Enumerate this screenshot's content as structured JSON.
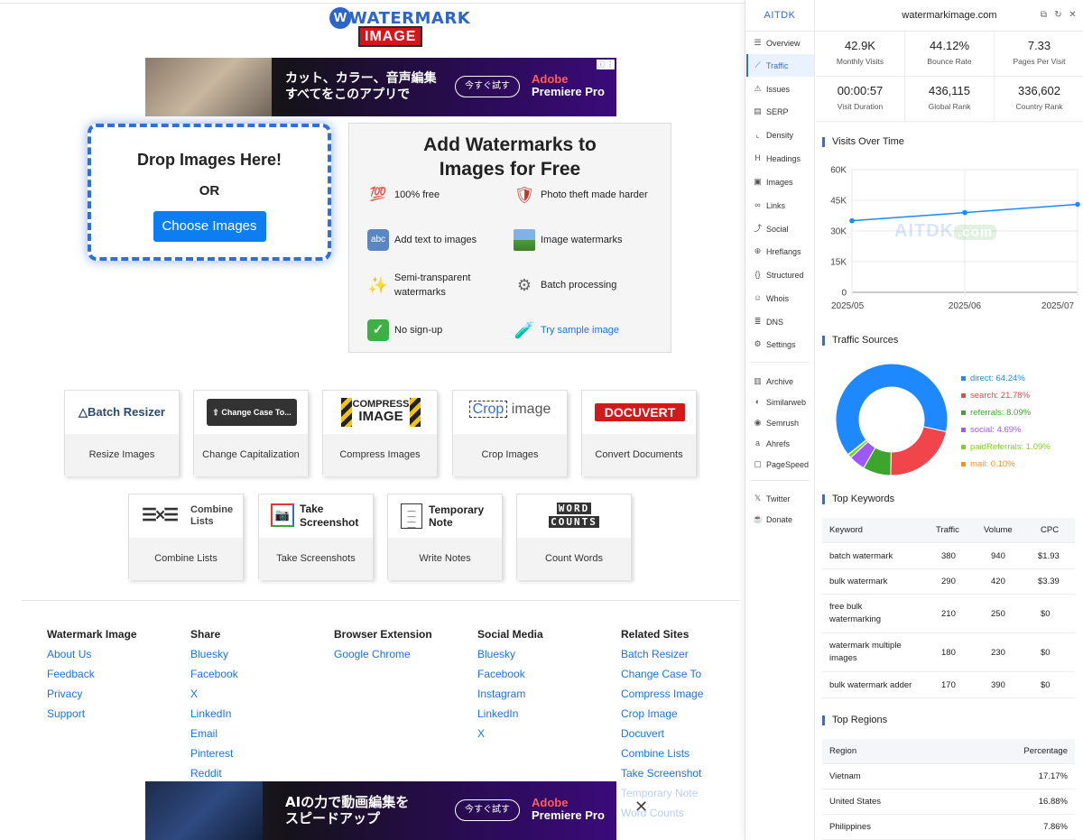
{
  "logo": {
    "word1": "WATERMARK",
    "word2": "IMAGE"
  },
  "ads": {
    "top": {
      "line1": "カット、カラー、音声編集",
      "line2": "すべてをこのアプリで",
      "cta": "今すぐ試す",
      "brand_line1": "Adobe",
      "brand_line2": "Premiere Pro"
    },
    "bottom": {
      "line1": "AIの力で動画編集を",
      "line2": "スピードアップ",
      "cta": "今すぐ試す",
      "brand_line1": "Adobe",
      "brand_line2": "Premiere Pro"
    }
  },
  "drop": {
    "title": "Drop Images Here!",
    "or": "OR",
    "button": "Choose Images"
  },
  "features": {
    "title_line1": "Add Watermarks to",
    "title_line2": "Images for Free",
    "items": [
      {
        "label": "100% free",
        "icon": "hundred-icon"
      },
      {
        "label": "Photo theft made harder",
        "icon": "shield-icon"
      },
      {
        "label": "Add text to images",
        "icon": "abc-icon"
      },
      {
        "label": "Image watermarks",
        "icon": "landscape-icon"
      },
      {
        "label": "Semi-transparent watermarks",
        "icon": "sparkles-icon"
      },
      {
        "label": "Batch processing",
        "icon": "gear-icon"
      },
      {
        "label": "No sign-up",
        "icon": "checkmark-icon"
      },
      {
        "label": "Try sample image",
        "icon": "test-tube-icon"
      }
    ]
  },
  "tools": [
    {
      "logo": "Batch Resizer",
      "label": "Resize Images"
    },
    {
      "logo": "Change Case To...",
      "label": "Change Capitalization"
    },
    {
      "logo_line1": "COMPRESS",
      "logo_line2": "IMAGE",
      "label": "Compress Images"
    },
    {
      "logo_a": "Crop",
      "logo_b": "image",
      "label": "Crop Images"
    },
    {
      "logo": "DOCUVERT",
      "label": "Convert Documents"
    },
    {
      "logo_line1": "Combine",
      "logo_line2": "Lists",
      "label": "Combine Lists"
    },
    {
      "logo_line1": "Take",
      "logo_line2": "Screenshot",
      "label": "Take Screenshots"
    },
    {
      "logo_line1": "Temporary",
      "logo_line2": "Note",
      "label": "Write Notes"
    },
    {
      "logo_line1": "WORD",
      "logo_line2": "COUNTS",
      "label": "Count Words"
    }
  ],
  "footer": {
    "columns": [
      {
        "heading": "Watermark Image",
        "links": [
          "About Us",
          "Feedback",
          "Privacy",
          "Support"
        ]
      },
      {
        "heading": "Share",
        "links": [
          "Bluesky",
          "Facebook",
          "X",
          "LinkedIn",
          "Email",
          "Pinterest",
          "Reddit"
        ]
      },
      {
        "heading": "Browser Extension",
        "links": [
          "Google Chrome"
        ]
      },
      {
        "heading": "Social Media",
        "links": [
          "Bluesky",
          "Facebook",
          "Instagram",
          "LinkedIn",
          "X"
        ]
      },
      {
        "heading": "Related Sites",
        "links": [
          "Batch Resizer",
          "Change Case To",
          "Compress Image",
          "Crop Image",
          "Docuvert",
          "Combine Lists",
          "Take Screenshot",
          "Temporary Note",
          "Word Counts"
        ]
      }
    ]
  },
  "panel": {
    "brand": "AITDK",
    "domain": "watermarkimage.com",
    "nav": [
      "Overview",
      "Traffic",
      "Issues",
      "SERP",
      "Density",
      "Headings",
      "Images",
      "Links",
      "Social",
      "Hreflangs",
      "Structured",
      "Whois",
      "DNS",
      "Settings",
      "Archive",
      "Similarweb",
      "Semrush",
      "Ahrefs",
      "PageSpeed",
      "Twitter",
      "Donate"
    ],
    "active_nav": "Traffic",
    "stats": [
      {
        "value": "42.9K",
        "label": "Monthly Visits"
      },
      {
        "value": "44.12%",
        "label": "Bounce Rate"
      },
      {
        "value": "7.33",
        "label": "Pages Per Visit"
      },
      {
        "value": "00:00:57",
        "label": "Visit Duration"
      },
      {
        "value": "436,115",
        "label": "Global Rank"
      },
      {
        "value": "336,602",
        "label": "Country Rank"
      }
    ],
    "visits_title": "Visits Over Time",
    "watermark_a": "AITDK",
    "watermark_b": ".com",
    "sources_title": "Traffic Sources",
    "keywords_title": "Top Keywords",
    "keywords_head": [
      "Keyword",
      "Traffic",
      "Volume",
      "CPC"
    ],
    "keywords": [
      [
        "batch watermark",
        "380",
        "940",
        "$1.93"
      ],
      [
        "bulk watermark",
        "290",
        "420",
        "$3.39"
      ],
      [
        "free bulk watermarking",
        "210",
        "250",
        "$0"
      ],
      [
        "watermark multiple images",
        "180",
        "230",
        "$0"
      ],
      [
        "bulk watermark adder",
        "170",
        "390",
        "$0"
      ]
    ],
    "regions_title": "Top Regions",
    "regions_head": [
      "Region",
      "Percentage"
    ],
    "regions": [
      [
        "Vietnam",
        "17.17%"
      ],
      [
        "United States",
        "16.88%"
      ],
      [
        "Philippines",
        "7.86%"
      ]
    ],
    "colors": {
      "accent": "#2f6fd6"
    }
  },
  "chart_data": [
    {
      "type": "line",
      "x": [
        "2025/05",
        "2025/06",
        "2025/07"
      ],
      "series": [
        {
          "values": [
            35000,
            39000,
            43000
          ]
        }
      ],
      "yticks": [
        "0",
        "15K",
        "30K",
        "45K",
        "60K"
      ],
      "ylim": [
        0,
        60000
      ],
      "grid": true
    },
    {
      "type": "pie",
      "labels": [
        "direct: 64.24%",
        "search: 21.78%",
        "referrals: 8.09%",
        "social: 4.69%",
        "paidReferrals: 1.09%",
        "mail: 0.10%"
      ],
      "values": [
        64.24,
        21.78,
        8.09,
        4.69,
        1.09,
        0.1
      ],
      "colors": [
        "#1e88ff",
        "#f0454b",
        "#3ca52d",
        "#9b59ff",
        "#7ed321",
        "#ff8c1a"
      ],
      "legend": "right"
    }
  ]
}
